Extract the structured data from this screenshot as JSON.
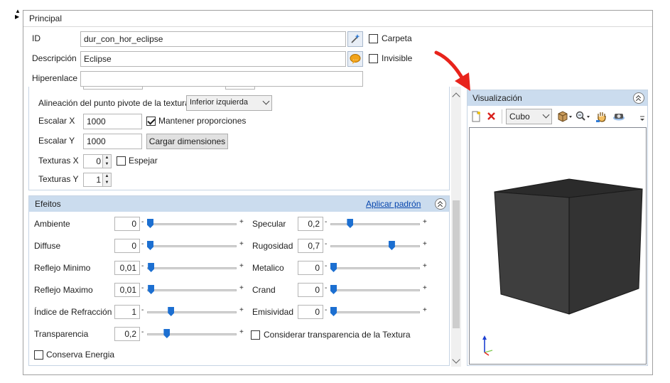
{
  "colors": {
    "accent_blue": "#1c6fd1",
    "panel_header": "#cbdcee",
    "link": "#0645ad",
    "arrow_red": "#e8231b",
    "cube_face": "#3c3c3c"
  },
  "side_toggle": {
    "up": "▲",
    "down": "▶"
  },
  "principal": {
    "title": "Principal",
    "id_label": "ID",
    "id_value": "dur_con_hor_eclipse",
    "descripcion_label": "Descripción",
    "descripcion_value": "Eclipse",
    "hiperenlace_label": "Hiperenlace",
    "hiperenlace_value": "",
    "carpeta_label": "Carpeta",
    "carpeta_checked": false,
    "invisible_label": "Invisible",
    "invisible_checked": false
  },
  "texture": {
    "pivot_label": "Alineación del punto pivote de la textura",
    "pivot_value": "Inferior izquierda",
    "escalar_x_label": "Escalar X",
    "escalar_x_value": "1000",
    "mantener_label": "Mantener proporciones",
    "mantener_checked": true,
    "escalar_y_label": "Escalar Y",
    "escalar_y_value": "1000",
    "cargar_button": "Cargar dimensiones",
    "texturas_x_label": "Texturas X",
    "texturas_x_value": "0",
    "espejar_label": "Espejar",
    "espejar_checked": false,
    "texturas_y_label": "Texturas Y",
    "texturas_y_value": "1"
  },
  "efeitos": {
    "title": "Efeitos",
    "aplicar_link": "Aplicar padrón",
    "minus": "-",
    "plus": "+",
    "left": [
      {
        "label": "Ambiente",
        "value": "0",
        "level": 0.0
      },
      {
        "label": "Diffuse",
        "value": "0",
        "level": 0.0
      },
      {
        "label": "Reflejo Minimo",
        "value": "0,01",
        "level": 0.01
      },
      {
        "label": "Reflejo Maximo",
        "value": "0,01",
        "level": 0.01
      },
      {
        "label": "Índice de Refracción",
        "value": "1",
        "level": 0.25
      },
      {
        "label": "Transparencia",
        "value": "0,2",
        "level": 0.2
      }
    ],
    "right": [
      {
        "label": "Specular",
        "value": "0,2",
        "level": 0.2
      },
      {
        "label": "Rugosidad",
        "value": "0,7",
        "level": 0.7
      },
      {
        "label": "Metalico",
        "value": "0",
        "level": 0.0
      },
      {
        "label": "Crand",
        "value": "0",
        "level": 0.0
      },
      {
        "label": "Emisividad",
        "value": "0",
        "level": 0.0
      }
    ],
    "considerar_label": "Considerar transparencia de la Textura",
    "considerar_checked": false,
    "conserva_label": "Conserva Energia",
    "conserva_checked": false
  },
  "visualizacion": {
    "title": "Visualización",
    "shape_value": "Cubo",
    "toolbar_icons": [
      "new-icon",
      "delete-icon",
      "cube-view-icon",
      "zoom-icon",
      "pan-hand-icon",
      "camera-icon",
      "overflow-icon"
    ]
  }
}
